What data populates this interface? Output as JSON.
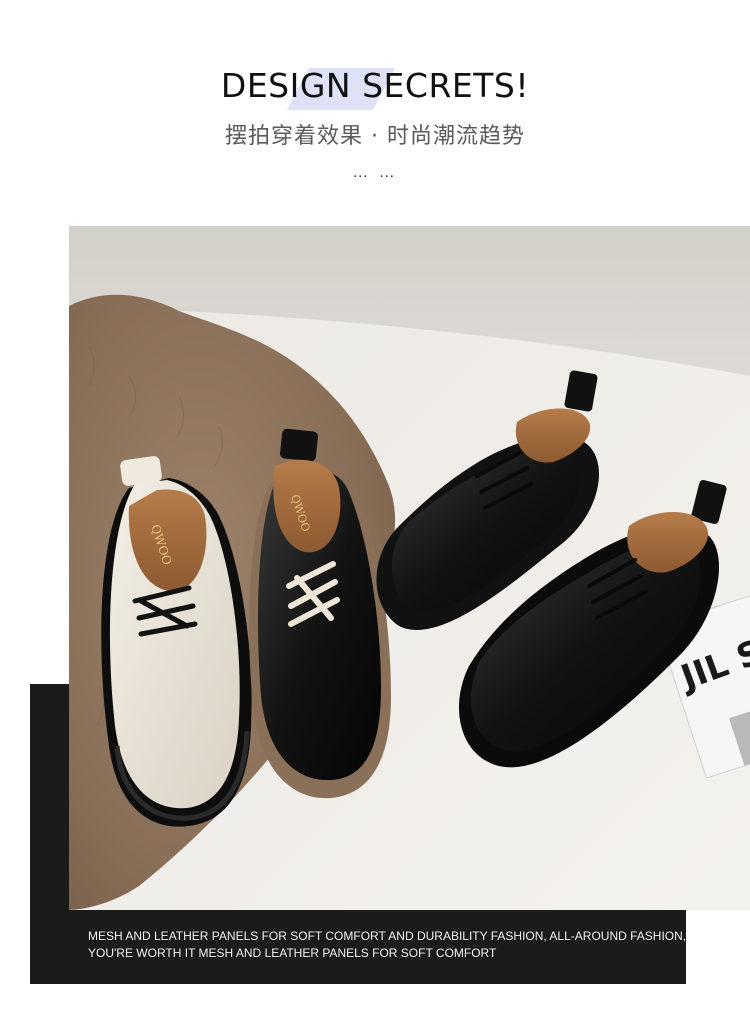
{
  "header": {
    "title": "DESIGN SECRETS!",
    "subtitle_left": "摆拍穿着效果",
    "subtitle_separator": "·",
    "subtitle_right": "时尚潮流趋势",
    "ellipsis": "… …"
  },
  "photo": {
    "shoe_brand_text": "QWOO",
    "magazine_text": "JIL SA"
  },
  "caption": {
    "line1": "MESH AND LEATHER PANELS FOR SOFT COMFORT AND DURABILITY FASHION, ALL-AROUND FASHION, D",
    "line2": "YOU'RE WORTH IT MESH AND LEATHER PANELS FOR SOFT COMFORT"
  },
  "colors": {
    "accent": "#dfe2f7",
    "dark_block": "#1b1b1b"
  }
}
